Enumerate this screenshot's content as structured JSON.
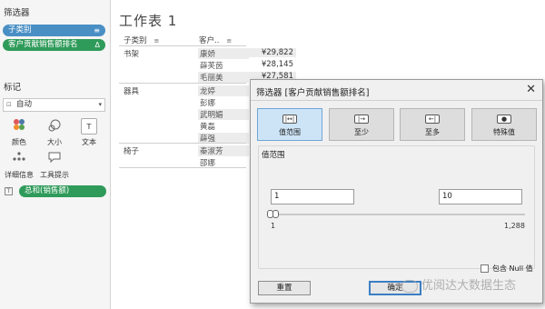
{
  "left_panel": {
    "filters_title": "筛选器",
    "filter_pills": [
      {
        "label": "子类别",
        "icon": "filter-icon"
      },
      {
        "label": "客户贡献销售额排名",
        "icon": "delta-icon"
      }
    ],
    "marks_title": "标记",
    "mark_type": "自动",
    "mark_buttons": [
      {
        "label": "颜色",
        "icon": "color-icon"
      },
      {
        "label": "大小",
        "icon": "size-icon"
      },
      {
        "label": "文本",
        "icon": "text-icon"
      },
      {
        "label": "详细信息",
        "icon": "detail-icon"
      },
      {
        "label": "工具提示",
        "icon": "tooltip-icon"
      }
    ],
    "measure_pill": "总和(销售额)"
  },
  "worksheet": {
    "title": "工作表 1",
    "col_category": "子类别",
    "col_customer": "客户..",
    "groups": [
      {
        "category": "书架",
        "rows": [
          {
            "customer": "康娇",
            "value": "¥29,822"
          },
          {
            "customer": "薛芙茵",
            "value": "¥28,145"
          },
          {
            "customer": "毛丽美",
            "value": "¥27,581"
          }
        ]
      },
      {
        "category": "器具",
        "rows": [
          {
            "customer": "龙婷",
            "value": ""
          },
          {
            "customer": "彭娜",
            "value": ""
          },
          {
            "customer": "武明媚",
            "value": ""
          },
          {
            "customer": "黄磊",
            "value": ""
          },
          {
            "customer": "薛强",
            "value": ""
          }
        ]
      },
      {
        "category": "椅子",
        "rows": [
          {
            "customer": "秦淑芳",
            "value": ""
          },
          {
            "customer": "邵娜",
            "value": ""
          }
        ]
      }
    ]
  },
  "dialog": {
    "title": "筛选器 [客户贡献销售额排名]",
    "mode_tabs": [
      {
        "label": "值范围",
        "icon": "range-icon",
        "active": true
      },
      {
        "label": "至少",
        "icon": "at-least-icon",
        "active": false
      },
      {
        "label": "至多",
        "icon": "at-most-icon",
        "active": false
      },
      {
        "label": "特殊值",
        "icon": "special-icon",
        "active": false
      }
    ],
    "range_label": "值范围",
    "min_value": "1",
    "max_value": "10",
    "slider_min": "1",
    "slider_max": "1,288",
    "null_label": "包含 Null 值",
    "reset_label": "重置",
    "ok_label": "确定"
  },
  "watermark": "优阅达大数据生态",
  "colors": {
    "pill_blue": "#4a8fc4",
    "pill_green": "#2f9b5a",
    "active_tab": "#cde4f7"
  }
}
